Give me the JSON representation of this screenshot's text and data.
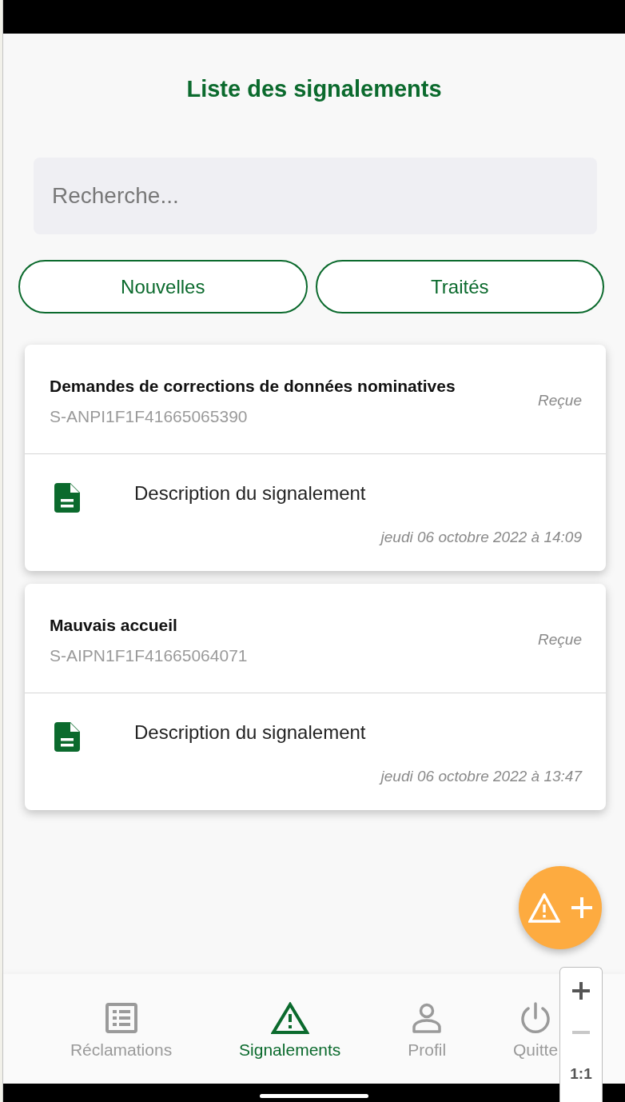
{
  "header": {
    "title": "Liste des signalements"
  },
  "search": {
    "placeholder": "Recherche..."
  },
  "filters": [
    {
      "label": "Nouvelles",
      "selected": false
    },
    {
      "label": "Traités",
      "selected": false
    }
  ],
  "reports": [
    {
      "title": "Demandes de corrections de données nominatives",
      "reference": "S-ANPI1F1F41665065390",
      "status": "Reçue",
      "description": "Description du signalement",
      "date": "jeudi 06 octobre 2022 à 14:09"
    },
    {
      "title": "Mauvais accueil",
      "reference": "S-AIPN1F1F41665064071",
      "status": "Reçue",
      "description": "Description du signalement",
      "date": "jeudi 06 octobre 2022 à 13:47"
    }
  ],
  "tab_bar": {
    "items": [
      {
        "label": "Réclamations",
        "selected": false
      },
      {
        "label": "Signalements",
        "selected": true
      },
      {
        "label": "Profil",
        "selected": false
      },
      {
        "label": "Quitte",
        "selected": false
      }
    ]
  },
  "zoom_control": {
    "buttons": [
      {
        "kind": "zoom-in",
        "disabled": false
      },
      {
        "kind": "zoom-out",
        "disabled": true
      },
      {
        "kind": "reset",
        "label": "1:1",
        "disabled": false
      }
    ]
  }
}
